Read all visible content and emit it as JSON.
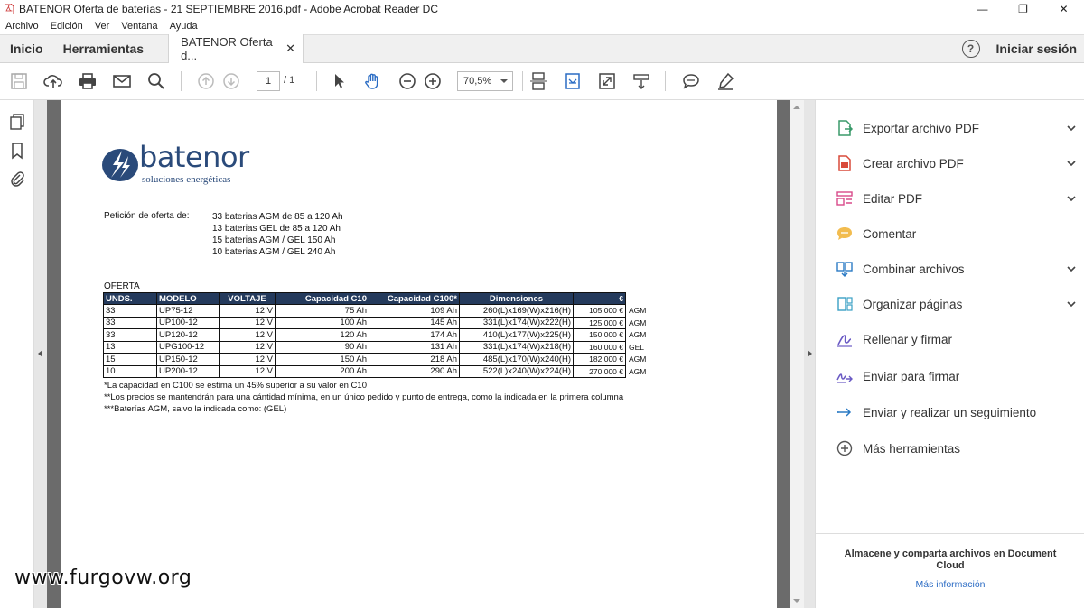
{
  "window": {
    "title": "BATENOR Oferta de baterías - 21 SEPTIEMBRE 2016.pdf - Adobe Acrobat Reader DC",
    "controls": [
      "—",
      "❐",
      "✕"
    ]
  },
  "menu": [
    "Archivo",
    "Edición",
    "Ver",
    "Ventana",
    "Ayuda"
  ],
  "tabs": {
    "home": "Inicio",
    "tools": "Herramientas",
    "document": "BATENOR Oferta d...",
    "close": "✕",
    "help": "?",
    "signin": "Iniciar sesión"
  },
  "toolbar": {
    "page_current": "1",
    "page_total": "/ 1",
    "zoom": "70,5%"
  },
  "document": {
    "logo_word": "batenor",
    "logo_sub": "soluciones energéticas",
    "request_label": "Petición de oferta de:",
    "request_items": [
      "33 baterias AGM de 85 a 120 Ah",
      "13 baterias GEL de 85 a 120 Ah",
      "15 baterias AGM / GEL 150 Ah",
      "10 baterias AGM / GEL 240 Ah"
    ],
    "oferta_label": "OFERTA",
    "table": {
      "headers": [
        "UNDS.",
        "MODELO",
        "VOLTAJE",
        "Capacidad C10",
        "Capacidad C100*",
        "Dimensiones",
        "€"
      ],
      "rows": [
        [
          "33",
          "UP75-12",
          "12 V",
          "75 Ah",
          "109 Ah",
          "260(L)x169(W)x216(H)",
          "105,000 €",
          "AGM"
        ],
        [
          "33",
          "UP100-12",
          "12 V",
          "100 Ah",
          "145 Ah",
          "331(L)x174(W)x222(H)",
          "125,000 €",
          "AGM"
        ],
        [
          "33",
          "UP120-12",
          "12 V",
          "120 Ah",
          "174 Ah",
          "410(L)x177(W)x225(H)",
          "150,000 €",
          "AGM"
        ],
        [
          "13",
          "UPG100-12",
          "12 V",
          "90 Ah",
          "131 Ah",
          "331(L)x174(W)x218(H)",
          "160,000 €",
          "GEL"
        ],
        [
          "15",
          "UP150-12",
          "12 V",
          "150 Ah",
          "218 Ah",
          "485(L)x170(W)x240(H)",
          "182,000 €",
          "AGM"
        ],
        [
          "10",
          "UP200-12",
          "12 V",
          "200 Ah",
          "290 Ah",
          "522(L)x240(W)x224(H)",
          "270,000 €",
          "AGM"
        ]
      ]
    },
    "footnotes": [
      "*La capacidad en C100 se estima un 45% superior a su valor en C10",
      "**Los precios se mantendrán para una cántidad mínima, en un único pedido y punto de entrega, como la indicada en la primera columna",
      "***Baterías AGM, salvo la indicada como: (GEL)"
    ]
  },
  "right_panel": {
    "tools": [
      {
        "label": "Exportar archivo PDF",
        "icon": "export-pdf-icon",
        "color": "#3a9a6a",
        "expandable": true
      },
      {
        "label": "Crear archivo PDF",
        "icon": "create-pdf-icon",
        "color": "#d94a3a",
        "expandable": true
      },
      {
        "label": "Editar PDF",
        "icon": "edit-pdf-icon",
        "color": "#d94a8a",
        "expandable": true
      },
      {
        "label": "Comentar",
        "icon": "comment-icon",
        "color": "#f0b030",
        "expandable": false
      },
      {
        "label": "Combinar archivos",
        "icon": "combine-files-icon",
        "color": "#2a7ac4",
        "expandable": true
      },
      {
        "label": "Organizar páginas",
        "icon": "organize-pages-icon",
        "color": "#3aa0c4",
        "expandable": true
      },
      {
        "label": "Rellenar y firmar",
        "icon": "fill-sign-icon",
        "color": "#6a5ac4",
        "expandable": false
      },
      {
        "label": "Enviar para firmar",
        "icon": "send-sign-icon",
        "color": "#6a5ac4",
        "expandable": false
      },
      {
        "label": "Enviar y realizar un seguimiento",
        "icon": "send-track-icon",
        "color": "#2a7ac4",
        "expandable": false
      },
      {
        "label": "Más herramientas",
        "icon": "more-tools-icon",
        "color": "#555555",
        "expandable": false
      }
    ],
    "cloud_text": "Almacene y comparta archivos en Document Cloud",
    "cloud_link": "Más información"
  },
  "watermark": "www.furgovw.org"
}
